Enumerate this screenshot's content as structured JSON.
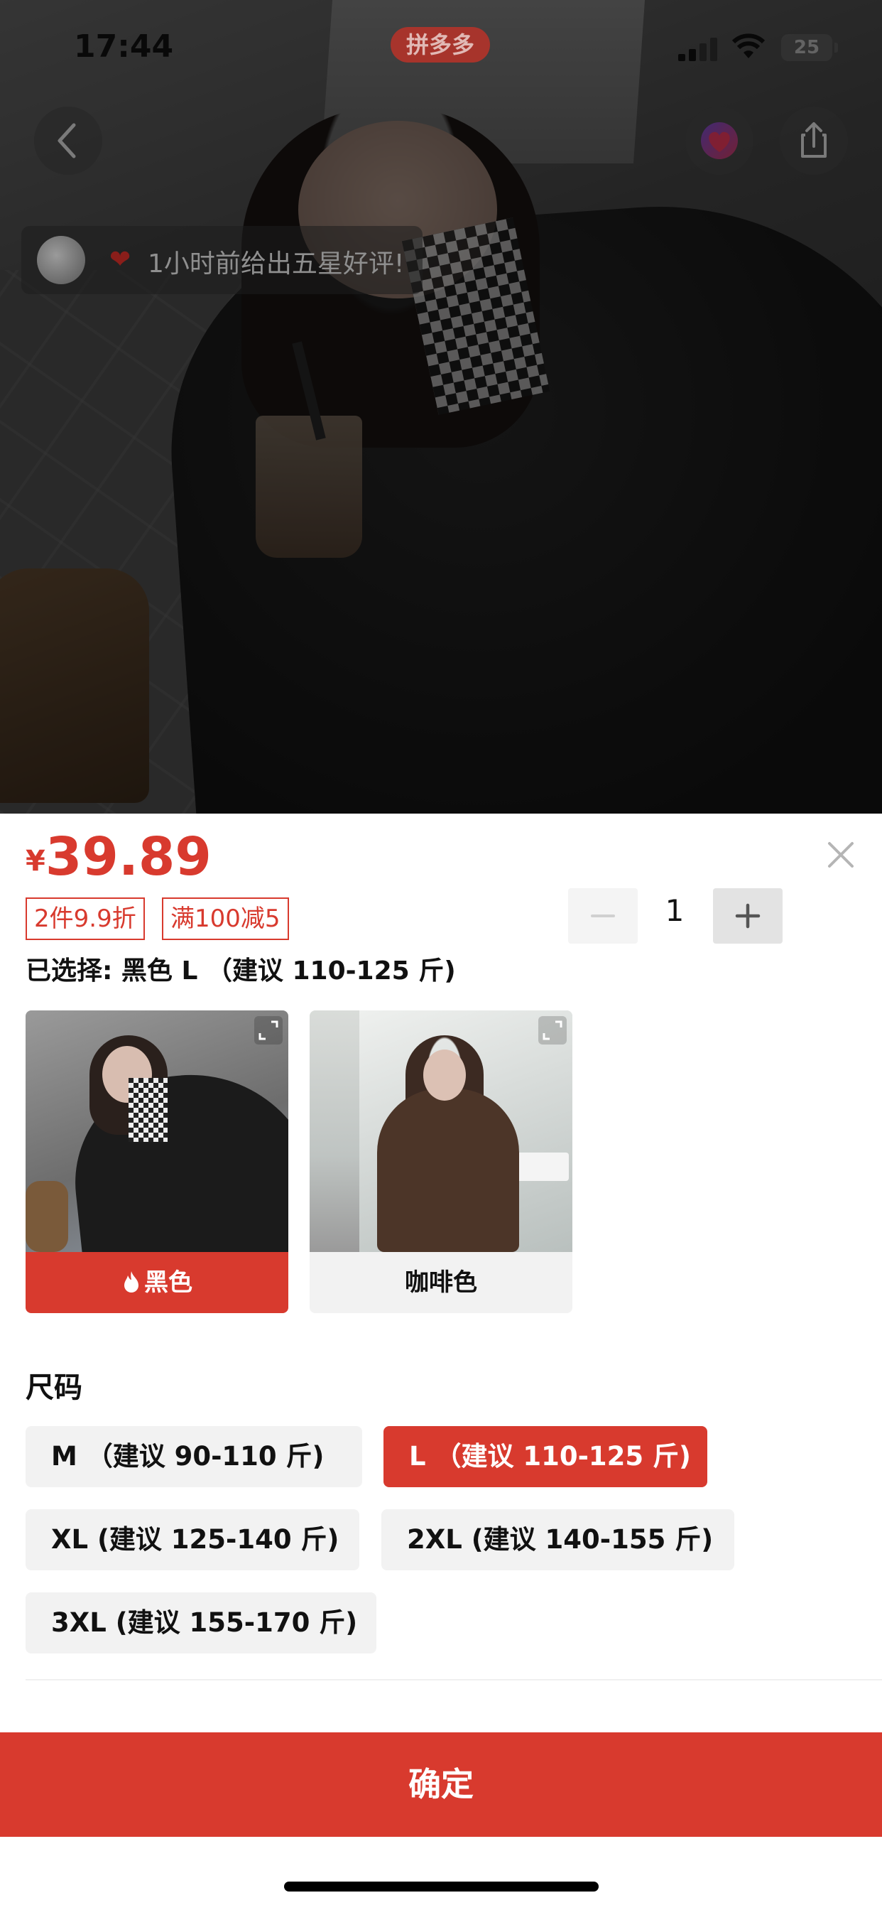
{
  "status_bar": {
    "time": "17:44",
    "app_badge": "拼多多",
    "battery": "25"
  },
  "overlay": {
    "review_text": "1小时前给出五星好评!"
  },
  "product": {
    "currency": "¥",
    "price": "39.89",
    "tags": [
      "2件9.9折",
      "满100减5"
    ],
    "quantity": "1",
    "selected_text": "已选择: 黑色 L （建议 110-125 斤)"
  },
  "colors": [
    {
      "label": "黑色",
      "selected": true
    },
    {
      "label": "咖啡色",
      "selected": false
    }
  ],
  "sizes": {
    "title": "尺码",
    "options": [
      {
        "label": "M （建议 90-110 斤)",
        "selected": false
      },
      {
        "label": "L （建议 110-125 斤)",
        "selected": true
      },
      {
        "label": "XL (建议 125-140 斤)",
        "selected": false
      },
      {
        "label": "2XL (建议 140-155 斤)",
        "selected": false
      },
      {
        "label": "3XL (建议 155-170 斤)",
        "selected": false
      }
    ]
  },
  "confirm_label": "确定",
  "theme": {
    "accent": "#d83a2e",
    "chip_bg": "#f2f2f2"
  }
}
